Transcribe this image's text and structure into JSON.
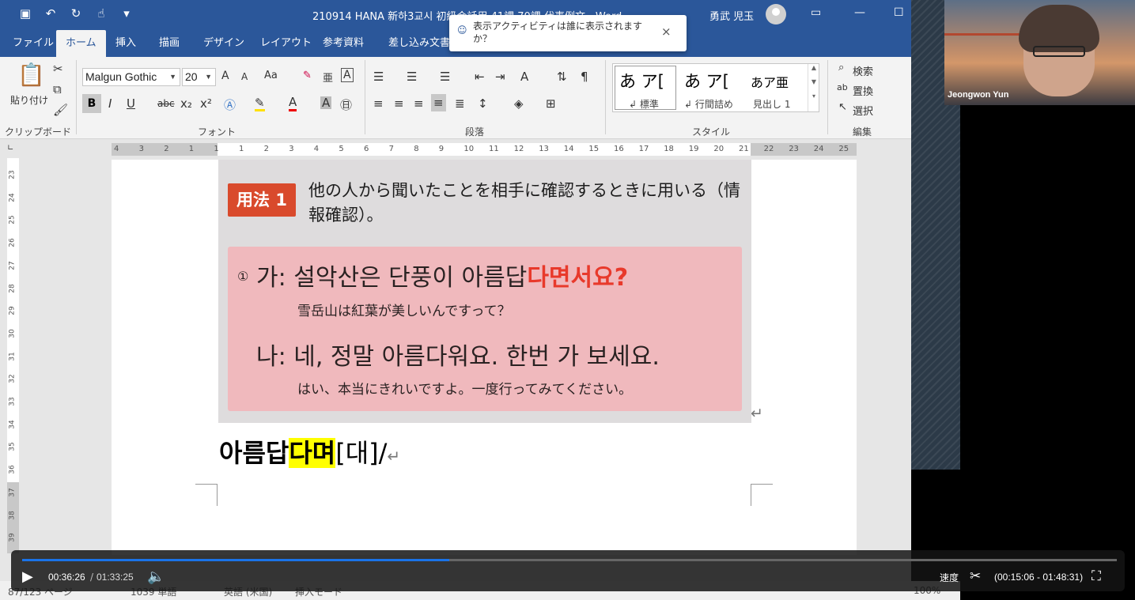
{
  "window": {
    "doc_title": "210914 HANA 新하3교시  初級会話用 41課 70課 代表例文 - Word",
    "user_name": "勇武 児玉",
    "qat_icons": [
      "save-icon",
      "undo-icon",
      "redo-icon",
      "touch-mode-icon",
      "customize-icon"
    ]
  },
  "tabs": [
    "ファイル",
    "ホーム",
    "挿入",
    "描画",
    "デザイン",
    "レイアウト",
    "参考資料",
    "差し込み文書"
  ],
  "active_tab": "ホーム",
  "tooltip": {
    "text": "表示アクティビティは誰に表示されますか？",
    "close": "×"
  },
  "ribbon": {
    "clipboard": {
      "paste": "貼り付け",
      "label": "クリップボード"
    },
    "font": {
      "name": "Malgun Gothic",
      "size": "20",
      "label": "フォント",
      "bold": "B",
      "italic": "I",
      "underline": "U",
      "strike": "abc",
      "sub": "x₂",
      "sup": "x²",
      "grow": "A",
      "shrink": "A",
      "case": "Aa",
      "phonetic": "亜",
      "border_char": "A",
      "color": "A",
      "shade": "A",
      "enclose": "㊐"
    },
    "paragraph": {
      "label": "段落"
    },
    "styles": {
      "label": "スタイル",
      "items": [
        {
          "preview": "あ ア[",
          "name": "↲ 標準"
        },
        {
          "preview": "あ ア[",
          "name": "↲ 行間詰め"
        },
        {
          "preview": "あア亜",
          "name": "見出し 1"
        }
      ]
    },
    "editing": {
      "label": "編集",
      "find": "検索",
      "replace": "置換",
      "select": "選択"
    }
  },
  "ruler": {
    "h_ticks": [
      "4",
      "3",
      "2",
      "1",
      "1",
      "1",
      "2",
      "3",
      "4",
      "5",
      "6",
      "7",
      "8",
      "9",
      "10",
      "11",
      "12",
      "13",
      "14",
      "15",
      "16",
      "17",
      "18",
      "19",
      "20",
      "21",
      "22",
      "23",
      "24",
      "25"
    ],
    "v_ticks": [
      "23",
      "24",
      "25",
      "26",
      "27",
      "28",
      "29",
      "30",
      "31",
      "32",
      "33",
      "34",
      "35",
      "36",
      "37",
      "38",
      "39"
    ]
  },
  "photo": {
    "badge": "用法 1",
    "usage_text": "他の人から聞いたことを相手に確認するときに用いる（情報確認）。",
    "ex_num": "①",
    "line1_a": "가: 설악산은 단풍이 아름답",
    "line1_red": "다면서요?",
    "line1_ja": "雪岳山は紅葉が美しいんですって？",
    "line2": "나: 네, 정말 아름다워요. 한번 가 보세요.",
    "line2_ja": "はい、本当にきれいですよ。一度行ってみてください。"
  },
  "document": {
    "main_pre": "아름답",
    "main_hl": "다며",
    "main_post": "[대]/",
    "para_mark": "↵"
  },
  "statusbar": {
    "page": "87/123 ページ",
    "words": "1039 単語",
    "lang": "英語 (米国)",
    "mode": "挿入モード",
    "zoom": "100%"
  },
  "webcam": {
    "name": "Jeongwon Yun"
  },
  "player": {
    "current": "00:36:26",
    "separator": "/",
    "total": "01:33:25",
    "progress": 0.39,
    "speed": "速度",
    "clip_range": "(00:15:06 - 01:48:31)"
  }
}
